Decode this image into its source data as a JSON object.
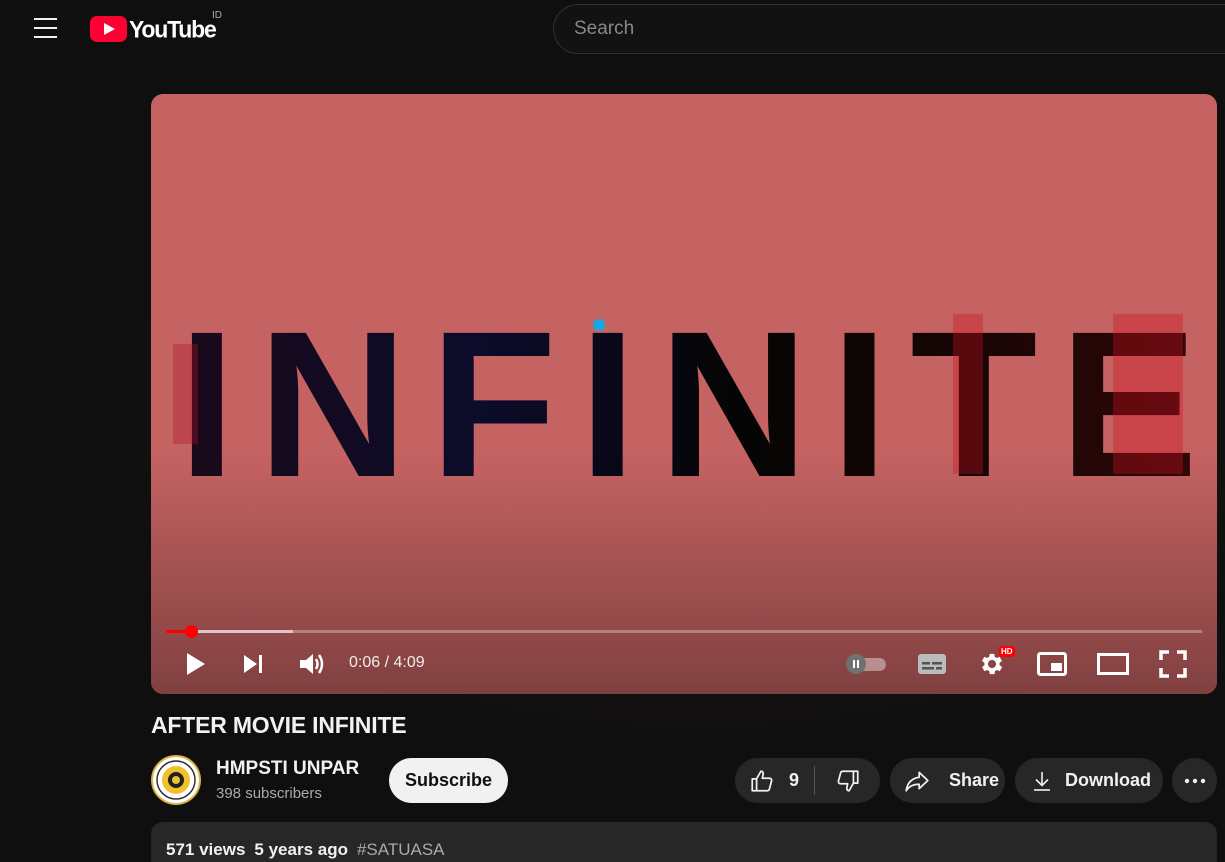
{
  "header": {
    "logo_text": "YouTube",
    "country_code": "ID",
    "search_placeholder": "Search"
  },
  "player": {
    "overlay_text": "INFINITE",
    "current_time": "0:06",
    "duration": "4:09",
    "time_display": "0:06 / 4:09",
    "progress_fraction": 0.024,
    "buffered_fraction": 0.123,
    "hd_badge": "HD",
    "autoplay_on": false,
    "colors": {
      "frame": "#c56262",
      "progress": "#ff0000"
    }
  },
  "video": {
    "title": "AFTER MOVIE INFINITE",
    "channel": {
      "name": "HMPSTI UNPAR",
      "subscribers": "398 subscribers"
    },
    "subscribe_label": "Subscribe",
    "like_count": "9",
    "share_label": "Share",
    "download_label": "Download"
  },
  "description": {
    "views": "571 views",
    "age": "5 years ago",
    "hashtag": "#SATUASA"
  }
}
